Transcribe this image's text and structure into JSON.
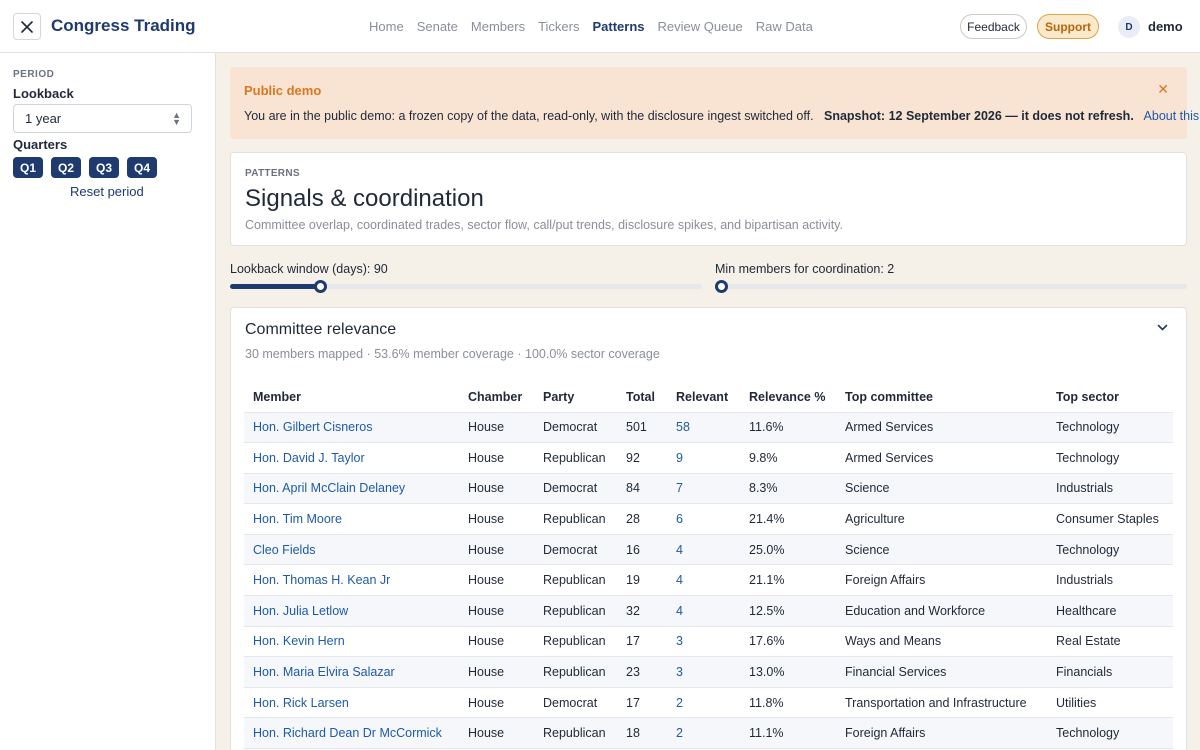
{
  "header": {
    "brand": "Congress Trading",
    "nav": [
      "Home",
      "Senate",
      "Members",
      "Tickers",
      "Patterns",
      "Review Queue",
      "Raw Data"
    ],
    "active_nav": "Patterns",
    "feedback_label": "Feedback",
    "support_label": "Support",
    "avatar_initial": "D",
    "username": "demo"
  },
  "sidebar": {
    "section": "PERIOD",
    "lookback_label": "Lookback",
    "lookback_value": "1 year",
    "quarters_label": "Quarters",
    "quarters": [
      "Q1",
      "Q2",
      "Q3",
      "Q4"
    ],
    "reset_label": "Reset period"
  },
  "banner": {
    "title": "Public demo",
    "message": "You are in the public demo: a frozen copy of the data, read-only, with the disclosure ingest switched off.",
    "snapshot": "Snapshot: 12 September 2026 — it does not refresh.",
    "link": "About this build",
    "close_glyph": "✕"
  },
  "page": {
    "eyebrow": "PATTERNS",
    "title": "Signals & coordination",
    "subtitle": "Committee overlap, coordinated trades, sector flow, call/put trends, disclosure spikes, and bipartisan activity."
  },
  "sliders": {
    "lookback_label": "Lookback window (days): 90",
    "lookback_fraction": 0.19,
    "min_members_label": "Min members for coordination: 2",
    "min_members_fraction": 0.0
  },
  "committee": {
    "title": "Committee relevance",
    "summary": "30 members mapped · 53.6% member coverage · 100.0% sector coverage",
    "columns": [
      "Member",
      "Chamber",
      "Party",
      "Total",
      "Relevant",
      "Relevance %",
      "Top committee",
      "Top sector"
    ],
    "rows": [
      [
        "Hon. Gilbert Cisneros",
        "House",
        "Democrat",
        "501",
        "58",
        "11.6%",
        "Armed Services",
        "Technology"
      ],
      [
        "Hon. David J. Taylor",
        "House",
        "Republican",
        "92",
        "9",
        "9.8%",
        "Armed Services",
        "Technology"
      ],
      [
        "Hon. April McClain Delaney",
        "House",
        "Democrat",
        "84",
        "7",
        "8.3%",
        "Science",
        "Industrials"
      ],
      [
        "Hon. Tim Moore",
        "House",
        "Republican",
        "28",
        "6",
        "21.4%",
        "Agriculture",
        "Consumer Staples"
      ],
      [
        "Cleo Fields",
        "House",
        "Democrat",
        "16",
        "4",
        "25.0%",
        "Science",
        "Technology"
      ],
      [
        "Hon. Thomas H. Kean Jr",
        "House",
        "Republican",
        "19",
        "4",
        "21.1%",
        "Foreign Affairs",
        "Industrials"
      ],
      [
        "Hon. Julia Letlow",
        "House",
        "Republican",
        "32",
        "4",
        "12.5%",
        "Education and Workforce",
        "Healthcare"
      ],
      [
        "Hon. Kevin Hern",
        "House",
        "Republican",
        "17",
        "3",
        "17.6%",
        "Ways and Means",
        "Real Estate"
      ],
      [
        "Hon. Maria Elvira Salazar",
        "House",
        "Republican",
        "23",
        "3",
        "13.0%",
        "Financial Services",
        "Financials"
      ],
      [
        "Hon. Rick Larsen",
        "House",
        "Democrat",
        "17",
        "2",
        "11.8%",
        "Transportation and Infrastructure",
        "Utilities"
      ],
      [
        "Hon. Richard Dean Dr McCormick",
        "House",
        "Republican",
        "18",
        "2",
        "11.1%",
        "Foreign Affairs",
        "Technology"
      ]
    ]
  }
}
